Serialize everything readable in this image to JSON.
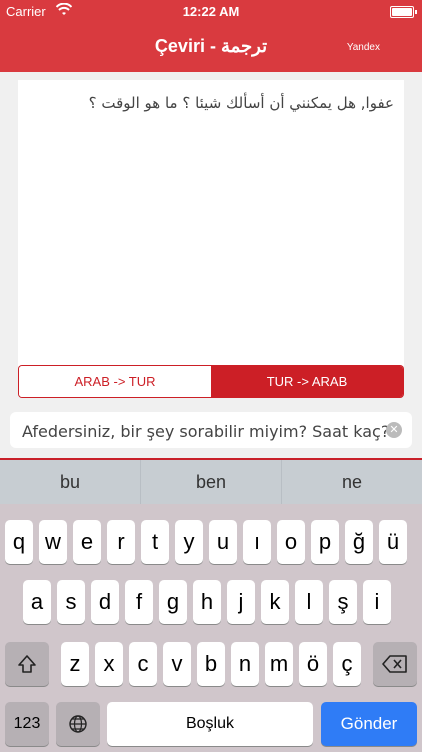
{
  "status": {
    "carrier": "Carrier",
    "time": "12:22 AM"
  },
  "header": {
    "title": "Çeviri - ترجمة",
    "provider": "Yandex"
  },
  "source": {
    "text": "عفوا, هل يمكنني أن أسألك شيئا ؟ ما هو الوقت ؟"
  },
  "segments": {
    "left": "ARAB -> TUR",
    "right": "TUR -> ARAB",
    "active": "right"
  },
  "input": {
    "value": "Afedersiniz, bir şey sorabilir miyim? Saat kaç?"
  },
  "keyboard": {
    "suggestions": [
      "bu",
      "ben",
      "ne"
    ],
    "row1": [
      "q",
      "w",
      "e",
      "r",
      "t",
      "y",
      "u",
      "ı",
      "o",
      "p",
      "ğ",
      "ü"
    ],
    "row2": [
      "a",
      "s",
      "d",
      "f",
      "g",
      "h",
      "j",
      "k",
      "l",
      "ş",
      "i"
    ],
    "row3": [
      "z",
      "x",
      "c",
      "v",
      "b",
      "n",
      "m",
      "ö",
      "ç"
    ],
    "numbers_label": "123",
    "space_label": "Boşluk",
    "send_label": "Gönder"
  },
  "colors": {
    "header": "#d93a3f",
    "accent": "#cc1f26",
    "send": "#2f7cf6"
  },
  "icons": {
    "wifi": "wifi-icon",
    "battery": "battery-icon",
    "shift": "shift-icon",
    "backspace": "backspace-icon",
    "globe": "globe-icon",
    "clear": "clear-icon"
  }
}
